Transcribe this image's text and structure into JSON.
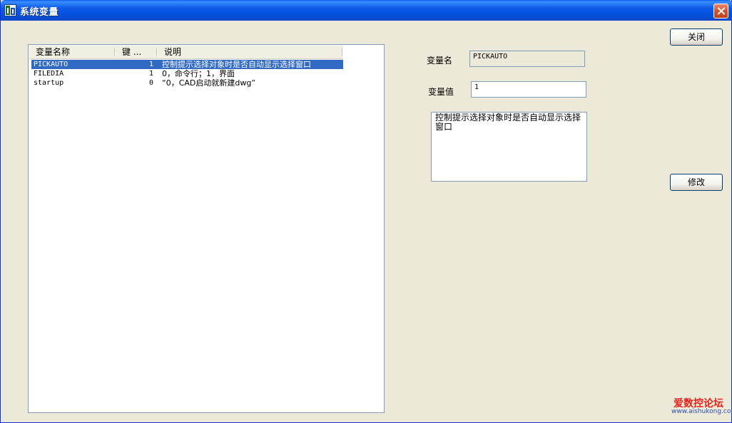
{
  "window": {
    "title": "系统变量"
  },
  "list": {
    "columns": [
      "变量名称",
      "键 ...",
      "说明"
    ],
    "rows": [
      {
        "name": "PICKAUTO",
        "key": "1",
        "desc": "控制提示选择对象时是否自动显示选择窗口",
        "selected": true
      },
      {
        "name": "FILEDIA",
        "key": "1",
        "desc": "0，命令行；1，界面",
        "selected": false
      },
      {
        "name": "startup",
        "key": "0",
        "desc": "“0，CAD启动就新建dwg”",
        "selected": false
      }
    ]
  },
  "details": {
    "name_label": "变量名",
    "name_value": "PICKAUTO",
    "value_label": "变量值",
    "value_value": "1",
    "description_line1": "控制提示选择对象时是否自动显示选择",
    "description_line2": "窗口"
  },
  "buttons": {
    "close": "关闭",
    "modify": "修改"
  },
  "watermark": {
    "name": "爱数控论坛",
    "url": "www.aishukong.com"
  },
  "colors": {
    "selection": "#316ac5",
    "titlebar": "#0a5bf0",
    "watermark": "#e0241d"
  }
}
